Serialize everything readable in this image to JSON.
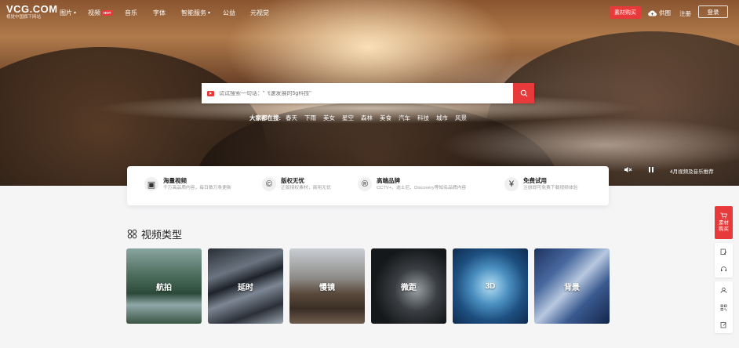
{
  "logo": {
    "main": "VCG.COM",
    "sub": "视觉中国旗下网站"
  },
  "nav": {
    "items": [
      {
        "label": "图片",
        "dropdown": true
      },
      {
        "label": "视频",
        "badge": "HOT"
      },
      {
        "label": "音乐"
      },
      {
        "label": "字体"
      },
      {
        "label": "智能服务",
        "dropdown": true
      },
      {
        "label": "公益"
      },
      {
        "label": "元视觉"
      }
    ],
    "buy": "素材购买",
    "upload": "供图",
    "register": "注册",
    "login": "登录"
  },
  "search": {
    "placeholder": "试试搜索一句话：\"飞速发展的5g科技\"",
    "hot_label": "大家都在搜:",
    "hot_terms": [
      "春天",
      "下雨",
      "美女",
      "星空",
      "森林",
      "美食",
      "汽车",
      "科技",
      "城市",
      "风景"
    ]
  },
  "hero": {
    "promo": "4月视频及音乐推荐"
  },
  "features": [
    {
      "icon": "video-box-icon",
      "glyph": "▣",
      "title": "海量视频",
      "desc": "千万高品质内容，每日数万条更新"
    },
    {
      "icon": "copyright-icon",
      "glyph": "©",
      "title": "版权无忧",
      "desc": "正版授权素材，商用无忧"
    },
    {
      "icon": "registered-icon",
      "glyph": "®",
      "title": "高端品牌",
      "desc": "CCTV+、迪士尼、Discovery等知名品牌内容"
    },
    {
      "icon": "yen-icon",
      "glyph": "¥",
      "title": "免费试用",
      "desc": "注册即可免费下载视频体验"
    }
  ],
  "section": {
    "title": "视频类型"
  },
  "categories": [
    "航拍",
    "延时",
    "慢镜",
    "微距",
    "3D",
    "背景"
  ],
  "rail": {
    "buy": "素材购买"
  }
}
